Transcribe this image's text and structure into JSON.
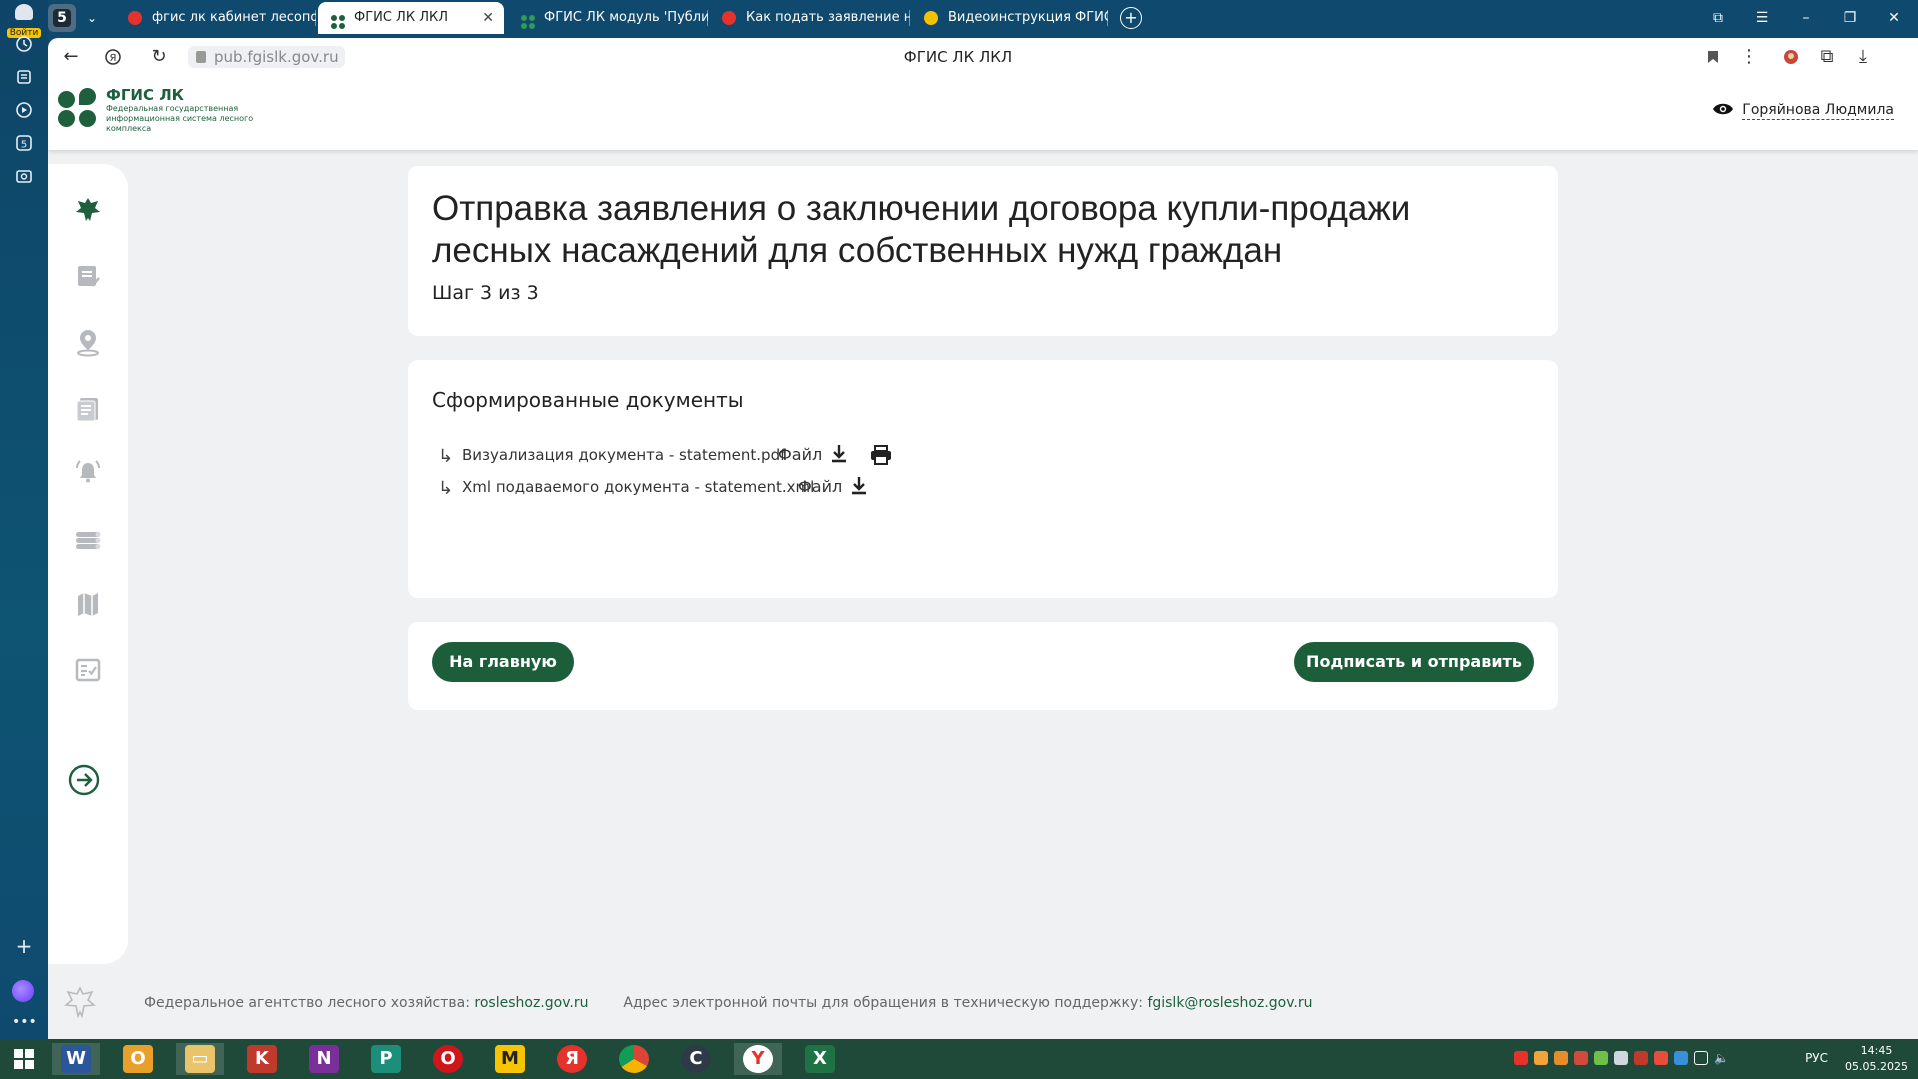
{
  "browser": {
    "login_label": "Войти",
    "tabs": [
      {
        "label": "фгис лк кабинет лесопол"
      },
      {
        "label": "ФГИС ЛК ЛКЛ"
      },
      {
        "label": "ФГИС ЛК модуль 'Публи"
      },
      {
        "label": "Как подать заявление на"
      },
      {
        "label": "Видеоинструкция ФГИС"
      }
    ],
    "url": "pub.fgislk.gov.ru",
    "page_title": "ФГИС ЛК ЛКЛ",
    "tab_counter": "5"
  },
  "header": {
    "logo_name": "ФГИС ЛК",
    "logo_sub": "Федеральная государственная информационная система лесного комплекса",
    "user_name": "Горяйнова Людмила"
  },
  "main": {
    "title": "Отправка заявления о заключении договора купли-продажи лесных насаждений для собственных нужд граждан",
    "step": "Шаг 3 из 3",
    "documents_heading": "Сформированные документы",
    "documents": [
      {
        "name": "Визуализация документа - statement.pdf",
        "file_label": "Файл"
      },
      {
        "name": "Xml подаваемого документа - statement.xml",
        "file_label": "Файл"
      }
    ],
    "home_button": "На главную",
    "sign_button": "Подписать и отправить"
  },
  "footer": {
    "agency_label": "Федеральное агентство лесного хозяйства:",
    "agency_link": "rosleshoz.gov.ru",
    "support_label": "Адрес электронной почты для обращения в техническую поддержку:",
    "support_email": "fgislk@rosleshoz.gov.ru"
  },
  "tray": {
    "lang": "РУС",
    "time": "14:45",
    "date": "05.05.2025"
  },
  "colors": {
    "brand_green": "#1d5e3a",
    "page_bg": "#f0f1f2"
  }
}
